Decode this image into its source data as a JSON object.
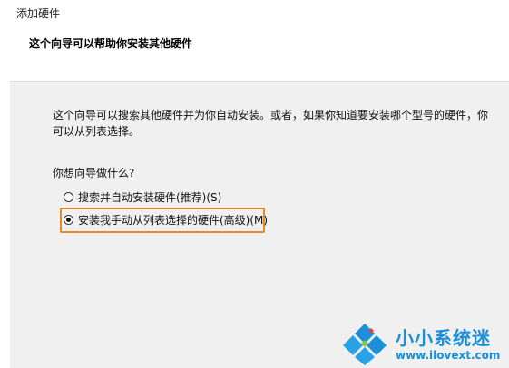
{
  "window": {
    "title": "添加硬件"
  },
  "header": {
    "heading": "这个向导可以帮助你安装其他硬件"
  },
  "content": {
    "intro_line1": "这个向导可以搜索其他硬件并为你自动安装。或者，如果你知道要安装哪个型号的硬件，你",
    "intro_line2": "可以从列表选择。",
    "question": "你想向导做什么?",
    "options": [
      {
        "label": "搜索并自动安装硬件(推荐)(S)",
        "selected": false
      },
      {
        "label": "安装我手动从列表选择的硬件(高级)(M)",
        "selected": true
      }
    ]
  },
  "highlight_color": "#e58a2b",
  "watermark": {
    "name": "小小系统迷",
    "url": "www.ilovext.com",
    "logo_icon": "windows-diamond-logo-icon",
    "color": "#1b8fd8"
  }
}
